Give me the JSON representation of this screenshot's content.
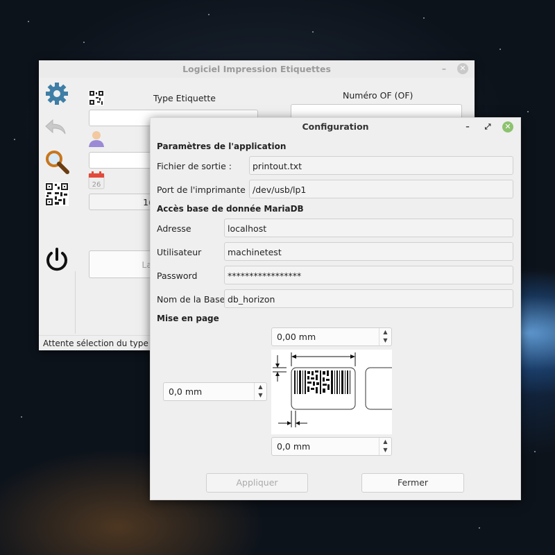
{
  "main_window": {
    "title": "Logiciel Impression Etiquettes",
    "type_label": "Type Etiquette",
    "of_label": "Numéro OF (OF)",
    "date_day": "26",
    "partial_field_text": "1(",
    "partial_button_text": "La",
    "status": "Attente sélection du type",
    "toolbar_icons": [
      "gear-icon",
      "undo-icon",
      "search-icon",
      "qrcode-icon",
      "power-icon"
    ]
  },
  "config_dialog": {
    "title": "Configuration",
    "section_app": "Paramètres de l'application",
    "output_file_label": "Fichier de sortie :",
    "output_file_value": "printout.txt",
    "printer_port_label": "Port de l'imprimante :",
    "printer_port_value": "/dev/usb/lp1",
    "section_db": "Accès base de donnée MariaDB",
    "address_label": "Adresse",
    "address_value": "localhost",
    "user_label": "Utilisateur",
    "user_value": "machinetest",
    "password_label": "Password",
    "password_value": "*****************",
    "dbname_label": "Nom de la Base",
    "dbname_value": "db_horizon",
    "section_layout": "Mise en page",
    "margin_top": "0,00 mm",
    "margin_left": "0,0 mm",
    "margin_bottom": "0,0 mm",
    "apply_label": "Appliquer",
    "close_label": "Fermer"
  },
  "colors": {
    "close_button_green": "#8dc26f",
    "dialog_bg": "#efefef"
  }
}
